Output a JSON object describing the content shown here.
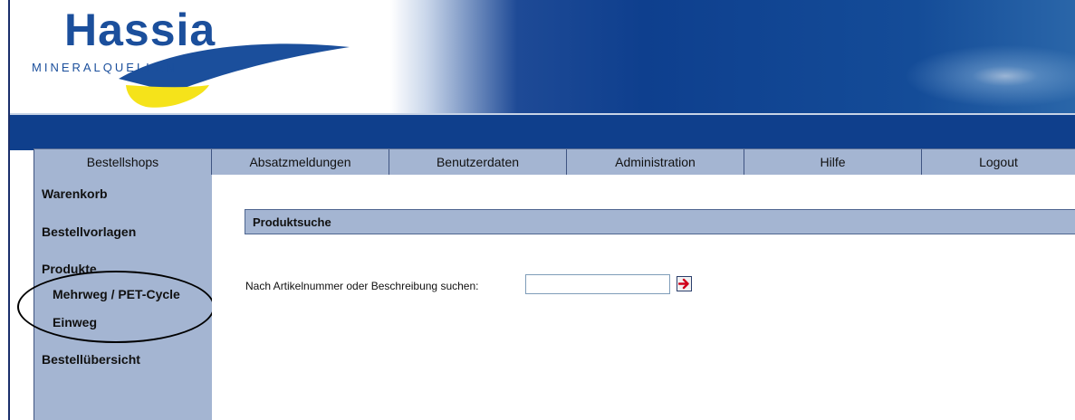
{
  "logo": {
    "name": "Hassia",
    "subtitle": "MINERALQUELLEN"
  },
  "nav": {
    "items": [
      {
        "label": "Bestellshops"
      },
      {
        "label": "Absatzmeldungen"
      },
      {
        "label": "Benutzerdaten"
      },
      {
        "label": "Administration"
      },
      {
        "label": "Hilfe"
      },
      {
        "label": "Logout"
      }
    ]
  },
  "sidebar": {
    "items": [
      {
        "label": "Warenkorb"
      },
      {
        "label": "Bestellvorlagen"
      },
      {
        "label": "Produkte"
      },
      {
        "label": "Mehrweg / PET-Cycle"
      },
      {
        "label": "Einweg"
      },
      {
        "label": "Bestellübersicht"
      }
    ]
  },
  "main": {
    "panel_title": "Produktsuche",
    "search_label": "Nach Artikelnummer oder Beschreibung suchen:",
    "search_value": "",
    "go_icon": "arrow-right-icon"
  },
  "colors": {
    "accent": "#a4b5d2",
    "brand_blue": "#0f3f8c",
    "logo_blue": "#1b4f9c",
    "logo_yellow": "#f5e31a",
    "arrow_red": "#d0021b"
  }
}
